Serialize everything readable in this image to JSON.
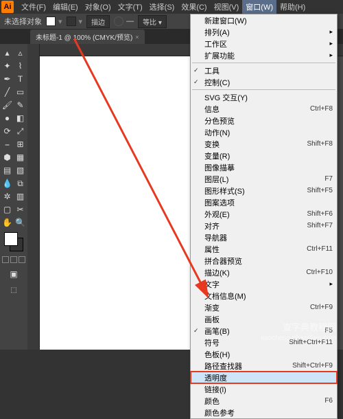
{
  "menubar": {
    "items": [
      "文件(F)",
      "编辑(E)",
      "对象(O)",
      "文字(T)",
      "选择(S)",
      "效果(C)",
      "视图(V)",
      "窗口(W)",
      "帮助(H)"
    ],
    "active_index": 7
  },
  "optbar": {
    "selection": "未选择对象",
    "stroke_btn": "描边",
    "uniform": "等比",
    "dash": "—"
  },
  "tab": {
    "title": "未标题-1 @ 100% (CMYK/预览)"
  },
  "dropdown": {
    "items": [
      {
        "label": "新建窗口(W)"
      },
      {
        "label": "排列(A)",
        "sub": true
      },
      {
        "label": "工作区",
        "sub": true
      },
      {
        "label": "扩展功能",
        "sub": true
      },
      {
        "sep": true
      },
      {
        "label": "工具",
        "check": true
      },
      {
        "label": "控制(C)",
        "check": true
      },
      {
        "sep": true
      },
      {
        "label": "SVG 交互(Y)"
      },
      {
        "label": "信息",
        "shortcut": "Ctrl+F8"
      },
      {
        "label": "分色预览"
      },
      {
        "label": "动作(N)"
      },
      {
        "label": "变换",
        "shortcut": "Shift+F8"
      },
      {
        "label": "变量(R)"
      },
      {
        "label": "图像描摹"
      },
      {
        "label": "图层(L)",
        "shortcut": "F7"
      },
      {
        "label": "图形样式(S)",
        "shortcut": "Shift+F5"
      },
      {
        "label": "图案选项"
      },
      {
        "label": "外观(E)",
        "shortcut": "Shift+F6"
      },
      {
        "label": "对齐",
        "shortcut": "Shift+F7"
      },
      {
        "label": "导航器"
      },
      {
        "label": "属性",
        "shortcut": "Ctrl+F11"
      },
      {
        "label": "拼合器预览"
      },
      {
        "label": "描边(K)",
        "shortcut": "Ctrl+F10"
      },
      {
        "label": "文字",
        "sub": true
      },
      {
        "label": "文档信息(M)"
      },
      {
        "label": "渐变",
        "shortcut": "Ctrl+F9"
      },
      {
        "label": "画板"
      },
      {
        "label": "画笔(B)",
        "check": true,
        "shortcut": "F5"
      },
      {
        "label": "符号",
        "shortcut": "Shift+Ctrl+F11"
      },
      {
        "label": "色板(H)"
      },
      {
        "label": "路径查找器",
        "shortcut": "Shift+Ctrl+F9"
      },
      {
        "label": "透明度",
        "hl": true
      },
      {
        "label": "链接(l)"
      },
      {
        "label": "颜色",
        "shortcut": "F6"
      },
      {
        "label": "颜色参考"
      }
    ]
  },
  "watermark": {
    "l1": "查字典教程网",
    "l2": "jiaocheng.chazidian.com"
  }
}
